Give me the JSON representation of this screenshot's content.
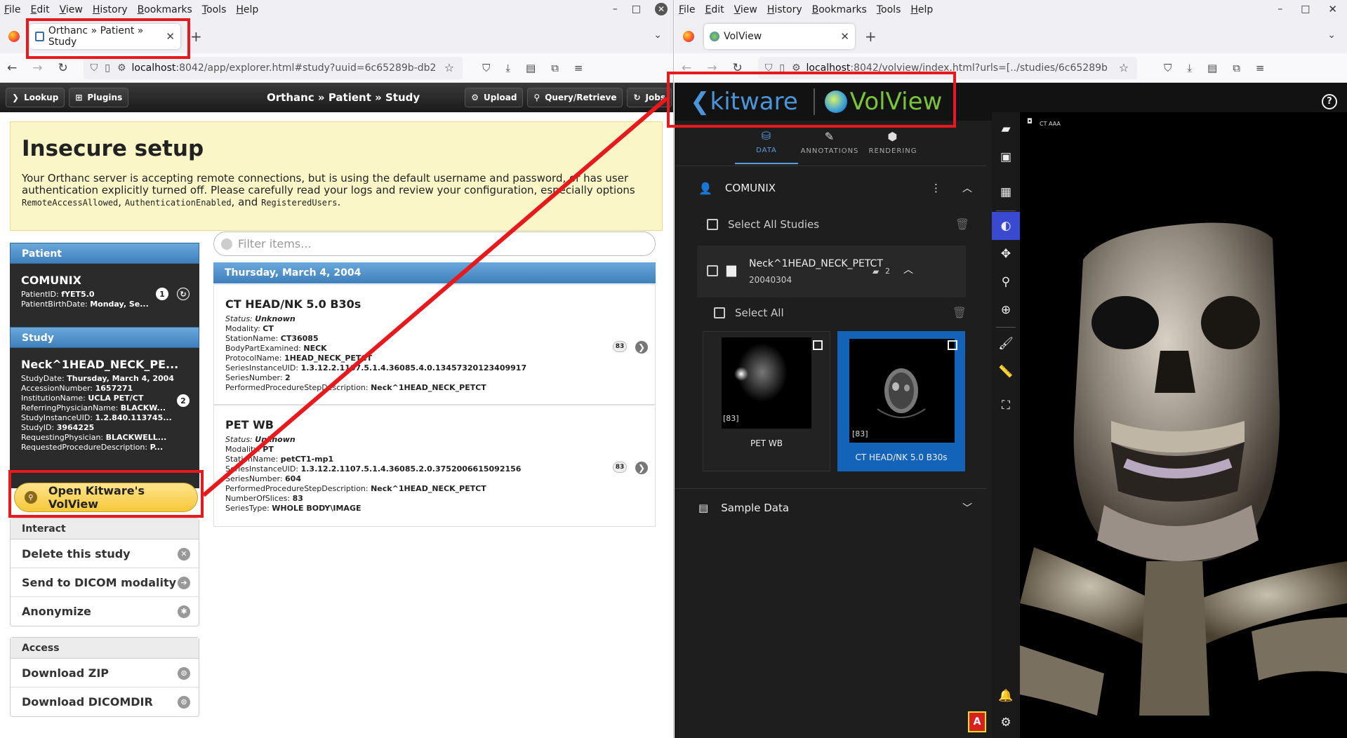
{
  "menu": [
    "File",
    "Edit",
    "View",
    "History",
    "Bookmarks",
    "Tools",
    "Help"
  ],
  "left": {
    "tab_title": "Orthanc » Patient » Study",
    "url_host": "localhost",
    "url_rest": ":8042/app/explorer.html#study?uuid=6c65289b-db2",
    "toolbar": {
      "lookup": "Lookup",
      "plugins": "Plugins",
      "title": "Orthanc » Patient » Study",
      "upload": "Upload",
      "query": "Query/Retrieve",
      "jobs": "Jobs"
    },
    "warning": {
      "title": "Insecure setup",
      "text1": "Your Orthanc server is accepting remote connections, but is using the default username and password, or has user authentication explicitly turned off. Please carefully read your logs and review your configuration, especially options",
      "code1": "RemoteAccessAllowed",
      "code2": "AuthenticationEnabled",
      "and": "and",
      "code3": "RegisteredUsers",
      "end": "."
    },
    "patient": {
      "header": "Patient",
      "name": "COMUNIX",
      "lines": [
        [
          "PatientID: ",
          "fYET5.0"
        ],
        [
          "PatientBirthDate: ",
          "Monday, Se..."
        ]
      ],
      "count": "1"
    },
    "study": {
      "header": "Study",
      "name": "Neck^1HEAD_NECK_PE...",
      "lines": [
        [
          "StudyDate: ",
          "Thursday, March 4, 2004"
        ],
        [
          "AccessionNumber: ",
          "1657271"
        ],
        [
          "InstitutionName: ",
          "UCLA PET/CT"
        ],
        [
          "ReferringPhysicianName: ",
          "BLACKW..."
        ],
        [
          "StudyInstanceUID: ",
          "1.2.840.113745..."
        ],
        [
          "StudyID: ",
          "3964225"
        ],
        [
          "RequestingPhysician: ",
          "BLACKWELL..."
        ],
        [
          "RequestedProcedureDescription: ",
          "P..."
        ]
      ],
      "count": "2"
    },
    "open_volview": "Open Kitware's VolView",
    "interact": {
      "header": "Interact",
      "items": [
        "Delete this study",
        "Send to DICOM modality",
        "Anonymize"
      ]
    },
    "access": {
      "header": "Access",
      "items": [
        "Download ZIP",
        "Download DICOMDIR"
      ]
    },
    "filter_placeholder": "Filter items...",
    "date_header": "Thursday, March 4, 2004",
    "series": [
      {
        "title": "CT HEAD/NK 5.0 B30s",
        "status": "Unknown",
        "lines": [
          [
            "Modality: ",
            "CT"
          ],
          [
            "StationName: ",
            "CT36085"
          ],
          [
            "BodyPartExamined: ",
            "NECK"
          ],
          [
            "ProtocolName: ",
            "1HEAD_NECK_PETCT"
          ],
          [
            "SeriesInstanceUID: ",
            "1.3.12.2.1107.5.1.4.36085.4.0.13457320123409917"
          ],
          [
            "SeriesNumber: ",
            "2"
          ],
          [
            "PerformedProcedureStepDescription: ",
            "Neck^1HEAD_NECK_PETCT"
          ]
        ],
        "count": "83"
      },
      {
        "title": "PET WB",
        "status": "Unknown",
        "lines": [
          [
            "Modality: ",
            "PT"
          ],
          [
            "StationName: ",
            "petCT1-mp1"
          ],
          [
            "SeriesInstanceUID: ",
            "1.3.12.2.1107.5.1.4.36085.2.0.3752006615092156"
          ],
          [
            "SeriesNumber: ",
            "604"
          ],
          [
            "PerformedProcedureStepDescription: ",
            "Neck^1HEAD_NECK_PETCT"
          ],
          [
            "NumberOfSlices: ",
            "83"
          ],
          [
            "SeriesType: ",
            "WHOLE BODY\\IMAGE"
          ]
        ],
        "count": "83"
      }
    ],
    "status_label": "Status: "
  },
  "right": {
    "tab_title": "VolView",
    "url_host": "localhost",
    "url_rest": ":8042/volview/index.html?urls=[../studies/6c65289b",
    "brand_kitware": "kitware",
    "brand_volview": "VolView",
    "tabs": [
      "DATA",
      "ANNOTATIONS",
      "RENDERING"
    ],
    "patient": "COMUNIX",
    "select_all_studies": "Select All Studies",
    "study_name": "Neck^1HEAD_NECK_PETCT",
    "study_date": "20040304",
    "study_series_count": "2",
    "select_all": "Select All",
    "thumbs": [
      {
        "label": "PET WB",
        "count": "[83]"
      },
      {
        "label": "CT HEAD/NK 5.0 B30s",
        "count": "[83]"
      }
    ],
    "sample_data": "Sample Data",
    "view_label": "CT AAA",
    "orientation": "A"
  }
}
